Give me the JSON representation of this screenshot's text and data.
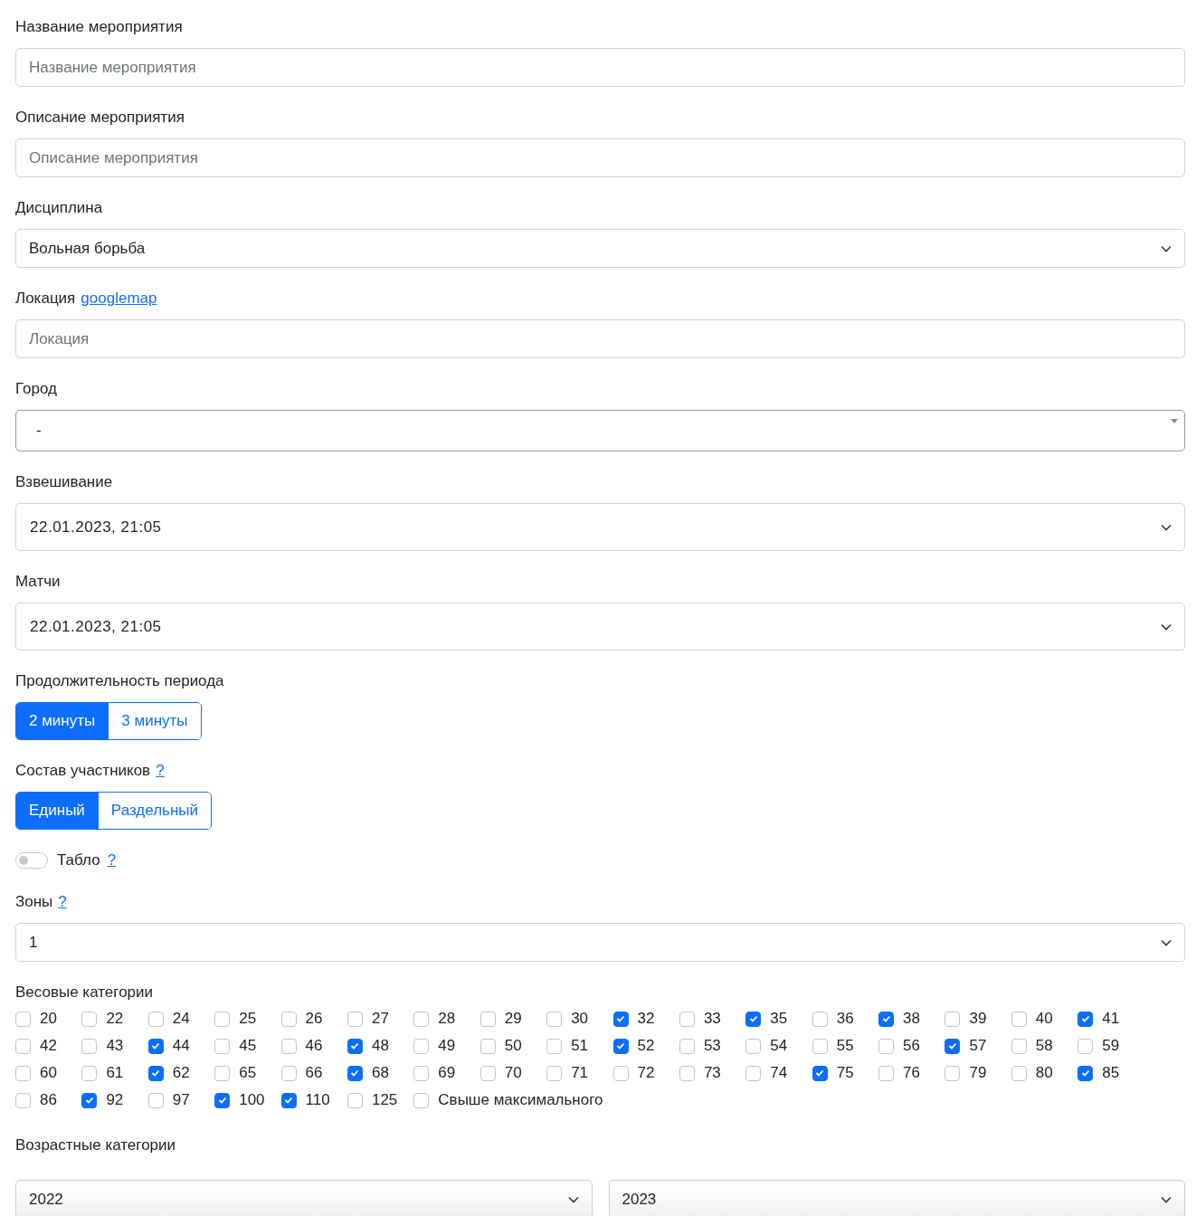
{
  "fields": [
    {
      "kind": "text",
      "label": "Название мероприятия",
      "placeholder": "Название мероприятия"
    },
    {
      "kind": "text",
      "label": "Описание мероприятия",
      "placeholder": "Описание мероприятия"
    },
    {
      "kind": "select",
      "label": "Дисциплина",
      "value": "Вольная борьба"
    },
    {
      "kind": "text",
      "label": "Локация",
      "link": "googlemap",
      "placeholder": "Локация"
    },
    {
      "kind": "combo",
      "label": "Город",
      "value": "-"
    },
    {
      "kind": "datetime",
      "label": "Взвешивание",
      "value": "22.01.2023, 21:05"
    },
    {
      "kind": "datetime",
      "label": "Матчи",
      "value": "22.01.2023, 21:05"
    },
    {
      "kind": "segmented",
      "label": "Продолжительность периода",
      "options": [
        {
          "label": "2 минуты",
          "selected": true
        },
        {
          "label": "3 минуты",
          "selected": false
        }
      ]
    },
    {
      "kind": "segmented",
      "label": "Состав участников",
      "help": "?",
      "options": [
        {
          "label": "Единый",
          "selected": true
        },
        {
          "label": "Раздельный",
          "selected": false
        }
      ]
    },
    {
      "kind": "toggle",
      "label": "Табло",
      "help": "?",
      "on": false
    },
    {
      "kind": "select",
      "label": "Зоны",
      "help": "?",
      "value": "1"
    },
    {
      "kind": "checkboxes",
      "label": "Весовые категории",
      "items": [
        {
          "label": "20",
          "checked": false
        },
        {
          "label": "22",
          "checked": false
        },
        {
          "label": "24",
          "checked": false
        },
        {
          "label": "25",
          "checked": false
        },
        {
          "label": "26",
          "checked": false
        },
        {
          "label": "27",
          "checked": false
        },
        {
          "label": "28",
          "checked": false
        },
        {
          "label": "29",
          "checked": false
        },
        {
          "label": "30",
          "checked": false
        },
        {
          "label": "32",
          "checked": true
        },
        {
          "label": "33",
          "checked": false
        },
        {
          "label": "35",
          "checked": true
        },
        {
          "label": "36",
          "checked": false
        },
        {
          "label": "38",
          "checked": true
        },
        {
          "label": "39",
          "checked": false
        },
        {
          "label": "40",
          "checked": false
        },
        {
          "label": "41",
          "checked": true
        },
        {
          "label": "42",
          "checked": false
        },
        {
          "label": "43",
          "checked": false
        },
        {
          "label": "44",
          "checked": true
        },
        {
          "label": "45",
          "checked": false
        },
        {
          "label": "46",
          "checked": false
        },
        {
          "label": "48",
          "checked": true
        },
        {
          "label": "49",
          "checked": false
        },
        {
          "label": "50",
          "checked": false
        },
        {
          "label": "51",
          "checked": false
        },
        {
          "label": "52",
          "checked": true
        },
        {
          "label": "53",
          "checked": false
        },
        {
          "label": "54",
          "checked": false
        },
        {
          "label": "55",
          "checked": false
        },
        {
          "label": "56",
          "checked": false
        },
        {
          "label": "57",
          "checked": true
        },
        {
          "label": "58",
          "checked": false
        },
        {
          "label": "59",
          "checked": false
        },
        {
          "label": "60",
          "checked": false
        },
        {
          "label": "61",
          "checked": false
        },
        {
          "label": "62",
          "checked": true
        },
        {
          "label": "65",
          "checked": false
        },
        {
          "label": "66",
          "checked": false
        },
        {
          "label": "68",
          "checked": true
        },
        {
          "label": "69",
          "checked": false
        },
        {
          "label": "70",
          "checked": false
        },
        {
          "label": "71",
          "checked": false
        },
        {
          "label": "72",
          "checked": false
        },
        {
          "label": "73",
          "checked": false
        },
        {
          "label": "74",
          "checked": false
        },
        {
          "label": "75",
          "checked": true
        },
        {
          "label": "76",
          "checked": false
        },
        {
          "label": "79",
          "checked": false
        },
        {
          "label": "80",
          "checked": false
        },
        {
          "label": "85",
          "checked": true
        },
        {
          "label": "86",
          "checked": false
        },
        {
          "label": "92",
          "checked": true
        },
        {
          "label": "97",
          "checked": false
        },
        {
          "label": "100",
          "checked": true
        },
        {
          "label": "110",
          "checked": true
        },
        {
          "label": "125",
          "checked": false
        },
        {
          "label": "Свыше максимального",
          "checked": false
        }
      ]
    },
    {
      "kind": "range",
      "label": "Возрастные категории",
      "values": [
        "2022",
        "2023"
      ]
    }
  ]
}
